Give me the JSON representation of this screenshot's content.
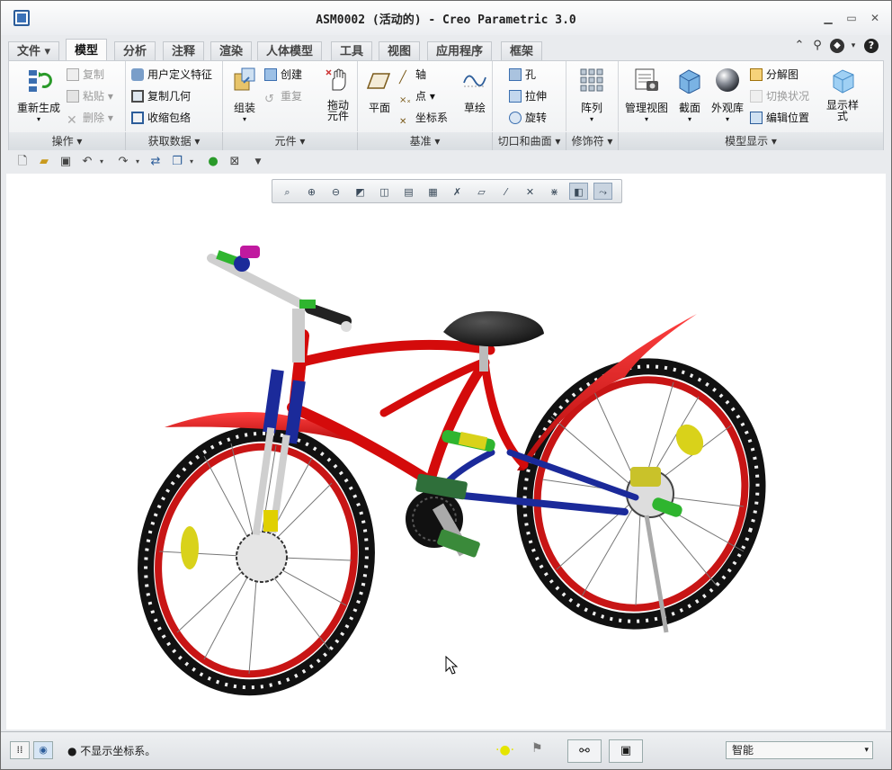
{
  "window": {
    "title": "ASM0002 (活动的) - Creo Parametric 3.0"
  },
  "tabs": [
    "文件",
    "模型",
    "分析",
    "注释",
    "渲染",
    "人体模型",
    "工具",
    "视图",
    "应用程序",
    "框架"
  ],
  "active_tab": "模型",
  "ribbon": {
    "operations": {
      "regenerate": "重新生成",
      "copy": "复制",
      "paste": "粘贴",
      "delete": "删除"
    },
    "get_data": {
      "udf": "用户定义特征",
      "copy_geom": "复制几何",
      "shrinkwrap": "收缩包络"
    },
    "component": {
      "assemble": "组装",
      "create": "创建",
      "repeat": "重复"
    },
    "drag": "拖动\n元件",
    "datum": {
      "plane": "平面",
      "axis": "轴",
      "point": "点",
      "csys": "坐标系",
      "sketch": "草绘"
    },
    "cut_surface": {
      "hole": "孔",
      "extrude": "拉伸",
      "revolve": "旋转"
    },
    "modifiers": {
      "pattern": "阵列"
    },
    "model_display": {
      "manage_views": "管理视图",
      "section": "截面",
      "appearance": "外观库",
      "exploded": "分解图",
      "toggle_state": "切换状况",
      "edit_position": "编辑位置",
      "display_style": "显示样\n式"
    },
    "group_labels": [
      "操作",
      "获取数据",
      "元件",
      "基准",
      "切口和曲面",
      "修饰符",
      "模型显示"
    ]
  },
  "status": {
    "message": "不显示坐标系。",
    "filter": "智能"
  },
  "colors": {
    "frame": "#d40b0b",
    "fork": "#1b2a9a",
    "tire": "#111111",
    "rim": "#c81515",
    "accent_green": "#2fb52f",
    "accent_yellow": "#d9d21a",
    "bell": "#c0199f"
  }
}
